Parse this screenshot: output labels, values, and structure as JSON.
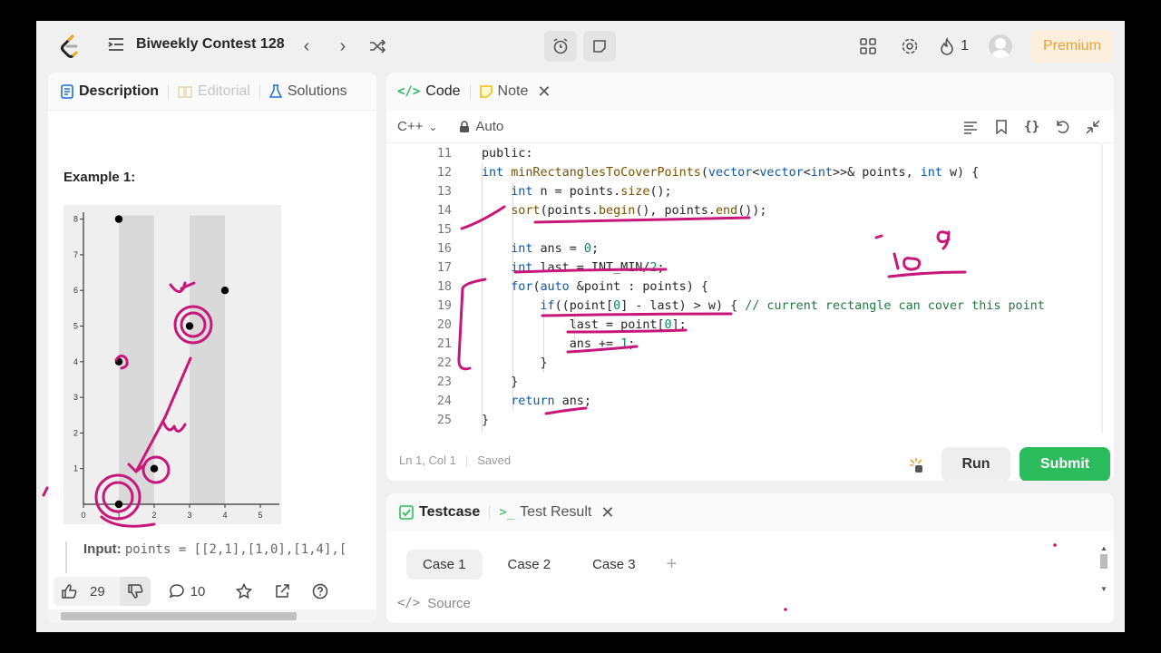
{
  "nav": {
    "contest_title": "Biweekly Contest 128",
    "streak_count": "1",
    "premium_label": "Premium"
  },
  "left": {
    "tabs": [
      {
        "label": "Description"
      },
      {
        "label": "Editorial"
      },
      {
        "label": "Solutions"
      }
    ],
    "example_title": "Example 1:",
    "plot": {
      "x_ticks": [
        "0",
        "1",
        "2",
        "3",
        "4",
        "5"
      ],
      "y_ticks": [
        "1",
        "2",
        "3",
        "4",
        "5",
        "6",
        "7",
        "8"
      ]
    },
    "input_label": "Input:",
    "input_value": "points = [[2,1],[1,0],[1,4],[",
    "likes": "29",
    "comments": "10"
  },
  "chart_data": {
    "type": "scatter",
    "x": [
      1,
      2,
      1,
      1,
      3,
      4
    ],
    "y": [
      0,
      1,
      4,
      8,
      5,
      6
    ],
    "xlim": [
      0,
      5
    ],
    "ylim": [
      0,
      8
    ],
    "shaded_bands": [
      [
        1,
        2
      ],
      [
        3,
        4
      ]
    ]
  },
  "code": {
    "tabs": [
      {
        "label": "Code"
      },
      {
        "label": "Note"
      }
    ],
    "language": "C++",
    "mode": "Auto",
    "lines": [
      {
        "n": "11",
        "text": "public:"
      },
      {
        "n": "12",
        "text": "    int minRectanglesToCoverPoints(vector<vector<int>>& points, int w) {"
      },
      {
        "n": "13",
        "text": "        int n = points.size();"
      },
      {
        "n": "14",
        "text": "        sort(points.begin(), points.end());"
      },
      {
        "n": "15",
        "text": ""
      },
      {
        "n": "16",
        "text": "        int ans = 0;"
      },
      {
        "n": "17",
        "text": "        int last = INT_MIN/2;"
      },
      {
        "n": "18",
        "text": "        for(auto &point : points) {"
      },
      {
        "n": "19",
        "text": "            if((point[0] - last) > w) { // current rectangle can cover this point"
      },
      {
        "n": "20",
        "text": "                last = point[0];"
      },
      {
        "n": "21",
        "text": "                ans += 1;"
      },
      {
        "n": "22",
        "text": "            }"
      },
      {
        "n": "23",
        "text": "        }"
      },
      {
        "n": "24",
        "text": "        return ans;"
      },
      {
        "n": "25",
        "text": "    }"
      }
    ],
    "status_pos": "Ln 1, Col 1",
    "status_saved": "Saved",
    "run_label": "Run",
    "submit_label": "Submit"
  },
  "test": {
    "tabs": [
      {
        "label": "Testcase"
      },
      {
        "label": "Test Result"
      }
    ],
    "cases": [
      "Case 1",
      "Case 2",
      "Case 3"
    ],
    "add_label": "+",
    "source_label": "Source"
  },
  "colors": {
    "accent_green": "#2cbb5d",
    "annotation": "#c8177a",
    "premium_text": "#e8a23c"
  }
}
